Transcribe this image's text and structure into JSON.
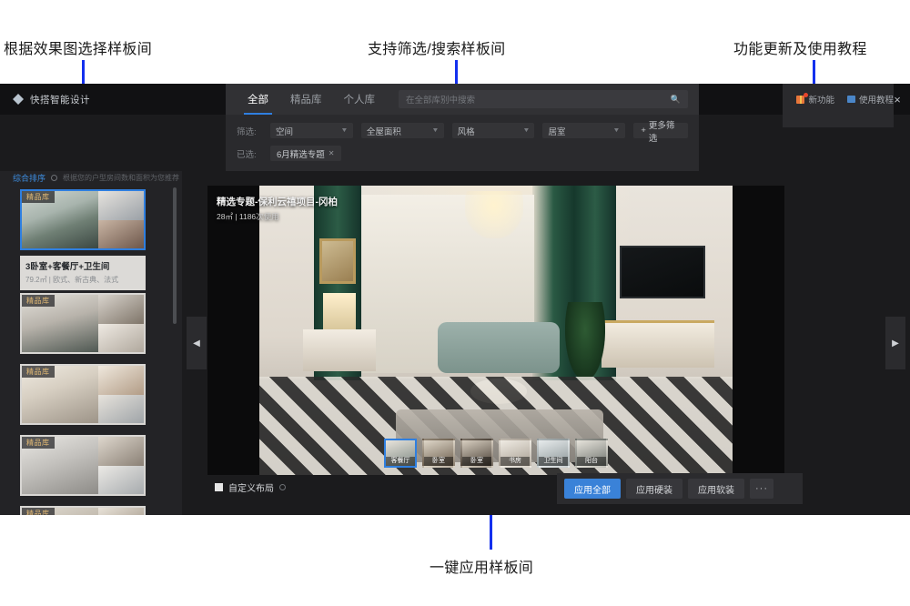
{
  "annotations": [
    {
      "text": "根据效果图选择样板间"
    },
    {
      "text": "支持筛选/搜索样板间"
    },
    {
      "text": "功能更新及使用教程"
    },
    {
      "text": "一键应用样板间"
    }
  ],
  "app": {
    "logo_text": "快搭智能设计",
    "close_label": "×"
  },
  "browse": {
    "tabs": [
      {
        "label": "全部",
        "active": true
      },
      {
        "label": "精品库",
        "active": false
      },
      {
        "label": "个人库",
        "active": false
      }
    ],
    "search": {
      "placeholder": "在全部库别中搜索",
      "value": "",
      "icon": "search-icon"
    },
    "filter_label": "筛选:",
    "filters": [
      {
        "label": "空间"
      },
      {
        "label": "全屋面积"
      },
      {
        "label": "风格"
      },
      {
        "label": "居室"
      }
    ],
    "more_filter_label": "更多筛选",
    "selected_label": "已选:",
    "selected_tags": [
      {
        "label": "6月精选专题"
      }
    ]
  },
  "top_right": {
    "new_feature_label": "新功能",
    "tutorial_label": "使用教程"
  },
  "rail": {
    "sort_label": "综合排序",
    "hint": "根据您的户型房间数和面积为您推荐",
    "cards": [
      {
        "badge": "精品库",
        "title": "3卧室+客餐厅+卫生间",
        "sub": "79.2㎡ | 欧式、新古典、法式",
        "selected": true
      },
      {
        "badge": "精品库",
        "title": "",
        "sub": "",
        "selected": false
      },
      {
        "badge": "精品库",
        "title": "",
        "sub": "",
        "selected": false
      },
      {
        "badge": "精品库",
        "title": "",
        "sub": "",
        "selected": false
      },
      {
        "badge": "精品库",
        "title": "",
        "sub": "",
        "selected": false
      }
    ]
  },
  "viewer": {
    "title": "精选专题-保利云禧项目-冈柏",
    "subtitle": "28㎡ | 1186次使用",
    "prev_label": "◀",
    "next_label": "▶",
    "rooms": [
      {
        "label": "客餐厅",
        "active": true
      },
      {
        "label": "卧室",
        "active": false
      },
      {
        "label": "卧室",
        "active": false
      },
      {
        "label": "书房",
        "active": false
      },
      {
        "label": "卫生间",
        "active": false
      },
      {
        "label": "阳台",
        "active": false
      }
    ]
  },
  "actions": {
    "custom_layout_label": "自定义布局",
    "buttons": [
      {
        "label": "应用全部",
        "primary": true
      },
      {
        "label": "应用硬装",
        "primary": false
      },
      {
        "label": "应用软装",
        "primary": false
      },
      {
        "label": "···",
        "primary": false,
        "more": true
      }
    ]
  },
  "colors": {
    "accent": "#2f7fe0",
    "leader": "#1330ee",
    "badge_gold": "#e0b874",
    "app_bg": "#1b1b1d"
  }
}
